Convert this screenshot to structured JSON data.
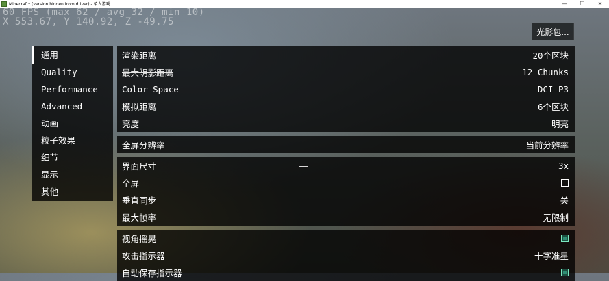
{
  "window": {
    "title": "Minecraft* (version hidden from driver) - 单人游戏",
    "minimize": "—",
    "maximize": "☐",
    "close": "✕"
  },
  "debug": {
    "line1": "60 FPS (max 62 / avg 32 / min 10)",
    "line2": "X 553.67, Y 140.92, Z -49.75"
  },
  "shader_button": "光影包...",
  "sidebar": {
    "items": [
      {
        "label": "通用",
        "active": true
      },
      {
        "label": "Quality"
      },
      {
        "label": "Performance"
      },
      {
        "label": "Advanced"
      },
      {
        "label": "动画"
      },
      {
        "label": "粒子效果"
      },
      {
        "label": "细节"
      },
      {
        "label": "显示"
      },
      {
        "label": "其他"
      }
    ]
  },
  "panel1": {
    "rows": [
      {
        "label": "渲染距离",
        "value": "20个区块"
      },
      {
        "label": "最大阴影距离",
        "value": "12 Chunks"
      },
      {
        "label": "Color Space",
        "value": "DCI_P3"
      },
      {
        "label": "模拟距离",
        "value": "6个区块"
      },
      {
        "label": "亮度",
        "value": "明亮"
      }
    ]
  },
  "panel2": {
    "rows": [
      {
        "label": "全屏分辨率",
        "value": "当前分辨率"
      }
    ]
  },
  "panel3": {
    "rows": [
      {
        "label": "界面尺寸",
        "value": "3x"
      },
      {
        "label": "全屏",
        "value": ""
      },
      {
        "label": "垂直同步",
        "value": "关"
      },
      {
        "label": "最大帧率",
        "value": "无限制"
      }
    ]
  },
  "panel4": {
    "rows": [
      {
        "label": "视角摇晃",
        "value": ""
      },
      {
        "label": "攻击指示器",
        "value": "十字准星"
      },
      {
        "label": "自动保存指示器",
        "value": ""
      }
    ]
  },
  "icons": {
    "app": "minecraft-grass-block-icon",
    "crosshair": "crosshair-icon"
  },
  "colors": {
    "panel_bg": "#000000",
    "checkbox_on": "#2f8f75",
    "checkbox_on_border": "#7be8c0"
  }
}
